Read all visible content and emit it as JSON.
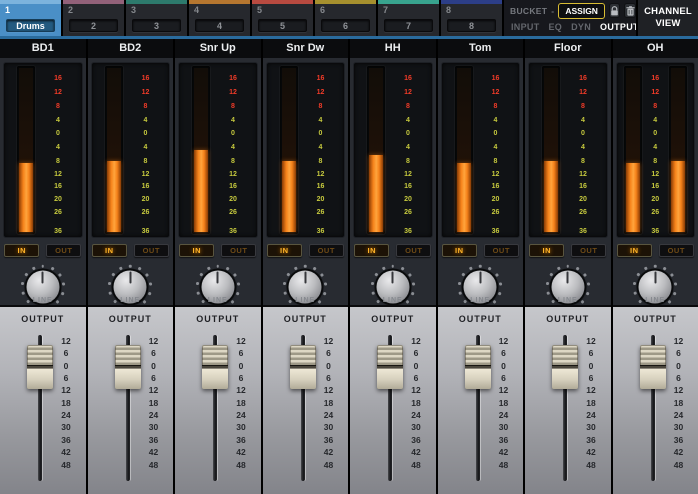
{
  "tabs": [
    {
      "number": "1",
      "label": "Drums",
      "selected": true,
      "stripe_color": "#7cb3dd"
    },
    {
      "number": "2",
      "label": "2",
      "selected": false,
      "stripe_color": "#926179"
    },
    {
      "number": "3",
      "label": "3",
      "selected": false,
      "stripe_color": "#2d7a6c"
    },
    {
      "number": "4",
      "label": "4",
      "selected": false,
      "stripe_color": "#b5762f"
    },
    {
      "number": "5",
      "label": "5",
      "selected": false,
      "stripe_color": "#b84a40"
    },
    {
      "number": "6",
      "label": "6",
      "selected": false,
      "stripe_color": "#a6902e"
    },
    {
      "number": "7",
      "label": "7",
      "selected": false,
      "stripe_color": "#38a38e"
    },
    {
      "number": "8",
      "label": "8",
      "selected": false,
      "stripe_color": "#2c3e88"
    }
  ],
  "bucket": {
    "label": "BUCKET",
    "value": "-",
    "assign_label": "ASSIGN",
    "views": [
      {
        "label": "INPUT",
        "active": false
      },
      {
        "label": "EQ",
        "active": false
      },
      {
        "label": "DYN",
        "active": false
      },
      {
        "label": "OUTPUT",
        "active": true
      }
    ]
  },
  "channel_view_label": "CHANNEL VIEW",
  "meter_scale": {
    "labels": [
      "16",
      "12",
      "8",
      "4",
      "0",
      "4",
      "8",
      "12",
      "16",
      "20",
      "26",
      "36"
    ],
    "red_count": 3
  },
  "fader_scale": [
    "12",
    "6",
    "0",
    "6",
    "12",
    "18",
    "24",
    "30",
    "36",
    "42",
    "48"
  ],
  "channels": [
    {
      "name": "BD1",
      "meters": [
        42
      ],
      "in_label": "IN",
      "out_label": "OUT",
      "in_active": true,
      "knob_label": "LINE",
      "section_label": "OUTPUT",
      "fader_db": "0"
    },
    {
      "name": "BD2",
      "meters": [
        43
      ],
      "in_label": "IN",
      "out_label": "OUT",
      "in_active": true,
      "knob_label": "LINE",
      "section_label": "OUTPUT",
      "fader_db": "0"
    },
    {
      "name": "Snr Up",
      "meters": [
        50
      ],
      "in_label": "IN",
      "out_label": "OUT",
      "in_active": true,
      "knob_label": "LINE",
      "section_label": "OUTPUT",
      "fader_db": "0"
    },
    {
      "name": "Snr Dw",
      "meters": [
        43
      ],
      "in_label": "IN",
      "out_label": "OUT",
      "in_active": true,
      "knob_label": "LINE",
      "section_label": "OUTPUT",
      "fader_db": "0"
    },
    {
      "name": "HH",
      "meters": [
        47
      ],
      "in_label": "IN",
      "out_label": "OUT",
      "in_active": true,
      "knob_label": "LINE",
      "section_label": "OUTPUT",
      "fader_db": "0"
    },
    {
      "name": "Tom",
      "meters": [
        42
      ],
      "in_label": "IN",
      "out_label": "OUT",
      "in_active": true,
      "knob_label": "LINE",
      "section_label": "OUTPUT",
      "fader_db": "0"
    },
    {
      "name": "Floor",
      "meters": [
        43
      ],
      "in_label": "IN",
      "out_label": "OUT",
      "in_active": true,
      "knob_label": "LINE",
      "section_label": "OUTPUT",
      "fader_db": "0"
    },
    {
      "name": "OH",
      "meters": [
        42,
        43
      ],
      "in_label": "IN",
      "out_label": "OUT",
      "in_active": true,
      "knob_label": "LINE",
      "section_label": "OUTPUT",
      "fader_db": "0"
    }
  ],
  "colors": {
    "selected_tab_blue": "#4a8fc7",
    "divider_blue": "#2a6b9d",
    "meter_orange": "#f5821a",
    "meter_scale_red": "#f03b28",
    "meter_scale_green": "#c6c93e",
    "in_led_amber": "#ffb428",
    "assign_border_yellow": "#d9bd34",
    "fader_cap_cream": "#ddd7c4"
  }
}
